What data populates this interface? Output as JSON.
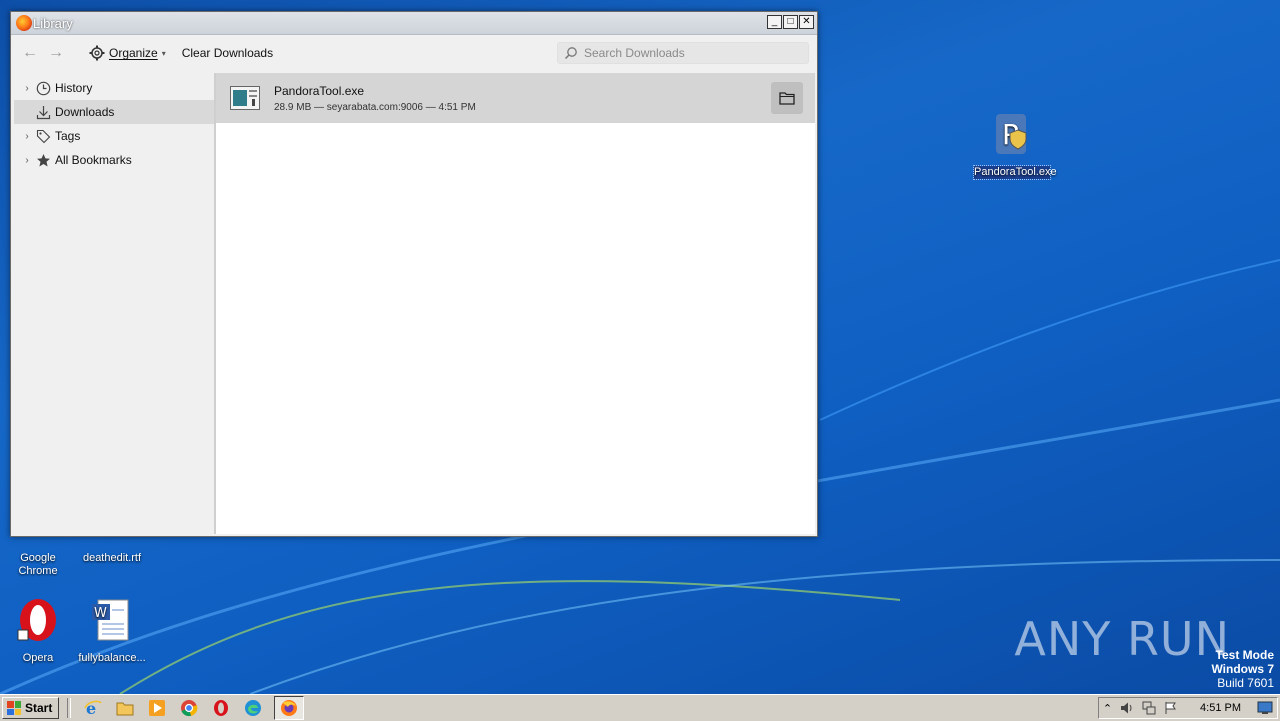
{
  "window": {
    "title": "Library",
    "toolbar": {
      "organize_label": "Organize",
      "clear_label": "Clear Downloads",
      "search_placeholder": "Search Downloads"
    },
    "sidebar": {
      "items": [
        {
          "label": "History",
          "icon": "clock-icon"
        },
        {
          "label": "Downloads",
          "icon": "download-icon"
        },
        {
          "label": "Tags",
          "icon": "tag-icon"
        },
        {
          "label": "All Bookmarks",
          "icon": "star-icon"
        }
      ]
    },
    "downloads": [
      {
        "name": "PandoraTool.exe",
        "details": "28.9 MB — seyarabata.com:9006 — 4:51 PM"
      }
    ]
  },
  "desktop": {
    "icons": {
      "pandora": "PandoraTool.exe",
      "chrome": "Google Chrome",
      "deathedit": "deathedit.rtf",
      "opera": "Opera",
      "fullybalance": "fullybalance..."
    },
    "watermark": "ANY RUN",
    "testmode": {
      "line1": "Test Mode",
      "line2": "Windows 7",
      "line3": "Build 7601"
    }
  },
  "taskbar": {
    "start_label": "Start",
    "clock": "4:51 PM"
  }
}
